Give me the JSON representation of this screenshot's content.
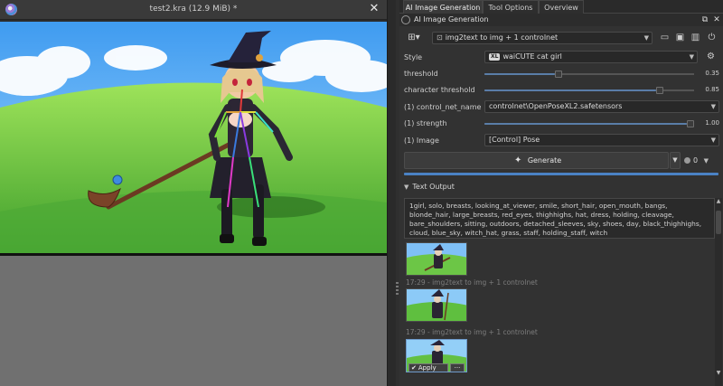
{
  "document": {
    "title": "test2.kra (12.9 MiB) *",
    "close_icon": "close-icon"
  },
  "tabs": [
    {
      "label": "AI Image Generation",
      "active": true
    },
    {
      "label": "Tool Options",
      "active": false
    },
    {
      "label": "Overview",
      "active": false
    }
  ],
  "docker": {
    "title": "AI Image Generation",
    "workspace": "img2text to img + 1 controlnet"
  },
  "style": {
    "label": "Style",
    "badge": "XL",
    "value": "waiCUTE cat girl"
  },
  "threshold": {
    "label": "threshold",
    "value": "0.35",
    "fraction": 0.35
  },
  "character_threshold": {
    "label": "character threshold",
    "value": "0.85",
    "fraction": 0.85
  },
  "control_net_name": {
    "label": "(1) control_net_name",
    "value": "controlnet\\OpenPoseXL2.safetensors"
  },
  "strength": {
    "label": "(1) strength",
    "value": "1.00",
    "fraction": 1.0
  },
  "image": {
    "label": "(1) Image",
    "value": "[Control] Pose"
  },
  "generate": {
    "label": "Generate",
    "queue_count": "0"
  },
  "text_output": {
    "header": "Text Output",
    "content": "1girl, solo, breasts, looking_at_viewer, smile, short_hair, open_mouth, bangs, blonde_hair, large_breasts, red_eyes, thighhighs, hat, dress, holding, cleavage, bare_shoulders, sitting, outdoors, detached_sleeves, sky, shoes, day, black_thighhighs, cloud, blue_sky, witch_hat, grass, staff, holding_staff, witch"
  },
  "history": [
    {
      "caption": "17:29 - img2text to img + 1 controlnet"
    },
    {
      "caption": "17:29 - img2text to img + 1 controlnet"
    },
    {
      "apply_label": "Apply",
      "more_label": "···"
    }
  ],
  "colors": {
    "accent": "#4a82c4",
    "panel_bg": "#323232",
    "canvas_gray": "#707070"
  }
}
